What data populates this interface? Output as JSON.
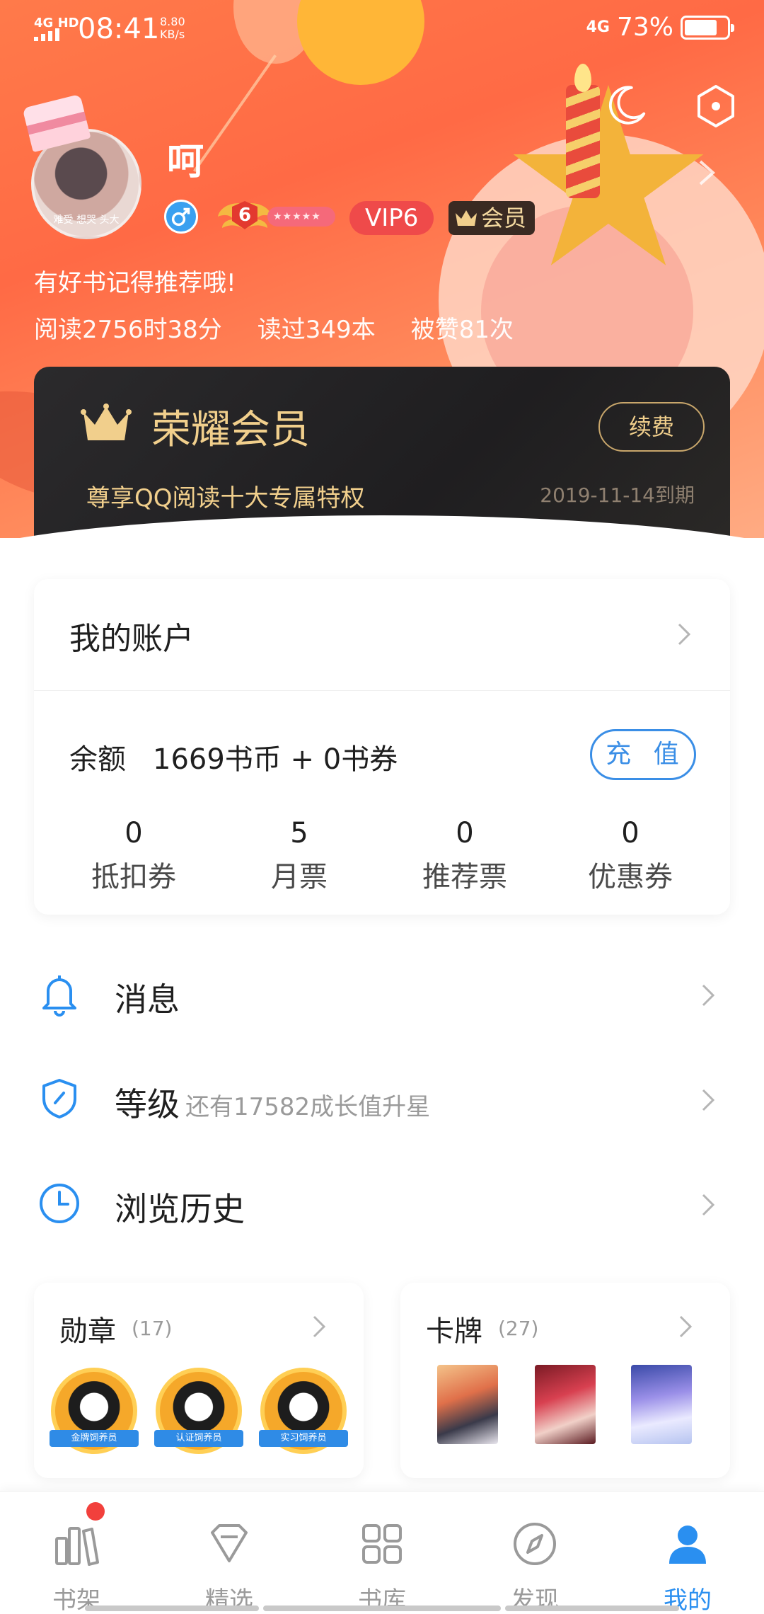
{
  "status_bar": {
    "network": "4G HD",
    "time": "08:41",
    "speed_value": "8.80",
    "speed_unit": "KB/s",
    "right_network": "4G",
    "battery": "73%"
  },
  "profile": {
    "username": "呵",
    "avatar_caption": "难受 想哭 头大",
    "level": "6",
    "vip": "VIP6",
    "member": "会员",
    "motto": "有好书记得推荐哦!",
    "stats": [
      "阅读2756时38分",
      "读过349本",
      "被赞81次"
    ]
  },
  "vip_card": {
    "title": "荣耀会员",
    "renew": "续费",
    "subtitle": "尊享QQ阅读十大专属特权",
    "expire": "2019-11-14到期"
  },
  "account": {
    "title": "我的账户",
    "balance_label": "余额",
    "balance_value": "1669书币 + 0书券",
    "recharge": "充 值",
    "tickets": [
      {
        "num": "0",
        "label": "抵扣券"
      },
      {
        "num": "5",
        "label": "月票"
      },
      {
        "num": "0",
        "label": "推荐票"
      },
      {
        "num": "0",
        "label": "优惠券"
      }
    ]
  },
  "menu": {
    "messages": "消息",
    "level": "等级",
    "level_hint": "还有17582成长值升星",
    "history": "浏览历史"
  },
  "medals": {
    "title": "勋章",
    "count": "(17)",
    "items": [
      "金牌饲养员",
      "认证饲养员",
      "实习饲养员"
    ]
  },
  "cards": {
    "title": "卡牌",
    "count": "(27)"
  },
  "tabs": [
    "书架",
    "精选",
    "书库",
    "发现",
    "我的"
  ],
  "colors": {
    "accent": "#2a8ff0",
    "hero": "#ff6a45",
    "gold": "#f1cf8c",
    "badge_red": "#f2403c"
  }
}
